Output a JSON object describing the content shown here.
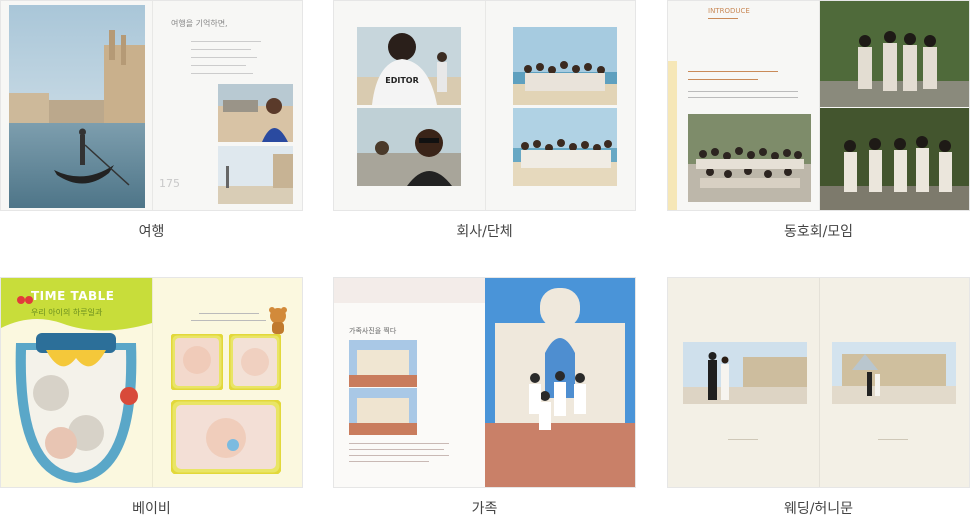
{
  "categories": [
    {
      "label": "여행"
    },
    {
      "label": "회사/단체"
    },
    {
      "label": "동호회/모임"
    },
    {
      "label": "베이비"
    },
    {
      "label": "가족"
    },
    {
      "label": "웨딩/허니문"
    }
  ],
  "thumbs": {
    "travel": {
      "heading": "여행을 기억하면,"
    },
    "company": {
      "shirt_text": "EDITOR"
    },
    "club": {
      "heading": "INTRODUCE"
    },
    "baby": {
      "title": "TIME TABLE",
      "subtitle": "우리 아이의 하루일과"
    },
    "family": {
      "heading": "가족사진을 찍다"
    }
  }
}
